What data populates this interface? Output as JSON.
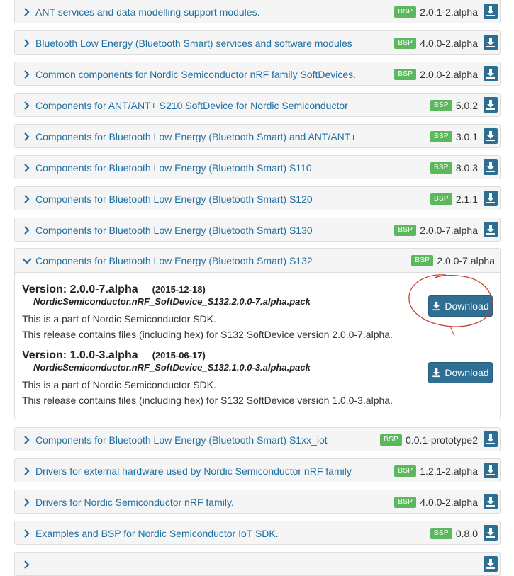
{
  "badge": "BSP",
  "packs_before": [
    {
      "title": "ANT services and data modelling support modules.",
      "version": "2.0.1-2.alpha"
    },
    {
      "title": "Bluetooth Low Energy (Bluetooth Smart) services and software modules",
      "version": "4.0.0-2.alpha"
    },
    {
      "title": "Common components for Nordic Semiconductor nRF family SoftDevices.",
      "version": "2.0.0-2.alpha"
    },
    {
      "title": "Components for ANT/ANT+ S210 SoftDevice for Nordic Semiconductor",
      "version": "5.0.2"
    },
    {
      "title": "Components for Bluetooth Low Energy (Bluetooth Smart) and ANT/ANT+",
      "version": "3.0.1"
    },
    {
      "title": "Components for Bluetooth Low Energy (Bluetooth Smart) S110",
      "version": "8.0.3"
    },
    {
      "title": "Components for Bluetooth Low Energy (Bluetooth Smart) S120",
      "version": "2.1.1"
    },
    {
      "title": "Components for Bluetooth Low Energy (Bluetooth Smart) S130",
      "version": "2.0.0-7.alpha"
    }
  ],
  "expanded": {
    "title": "Components for Bluetooth Low Energy (Bluetooth Smart) S132",
    "version": "2.0.0-7.alpha",
    "releases": [
      {
        "version_label": "Version: 2.0.0-7.alpha",
        "date": "(2015-12-18)",
        "pack": "NordicSemiconductor.nRF_SoftDevice_S132.2.0.0-7.alpha.pack",
        "desc1": "This is a part of Nordic Semiconductor SDK.",
        "desc2": "This release contains files (including hex) for S132 SoftDevice version 2.0.0-7.alpha.",
        "button": "Download"
      },
      {
        "version_label": "Version: 1.0.0-3.alpha",
        "date": "(2015-06-17)",
        "pack": "NordicSemiconductor.nRF_SoftDevice_S132.1.0.0-3.alpha.pack",
        "desc1": "This is a part of Nordic Semiconductor SDK.",
        "desc2": "This release contains files (including hex) for S132 SoftDevice version 1.0.0-3.alpha.",
        "button": "Download"
      }
    ]
  },
  "packs_after": [
    {
      "title": "Components for Bluetooth Low Energy (Bluetooth Smart) S1xx_iot",
      "version": "0.0.1-prototype2"
    },
    {
      "title": "Drivers for external hardware used by Nordic Semiconductor nRF family",
      "version": "1.2.1-2.alpha"
    },
    {
      "title": "Drivers for Nordic Semiconductor nRF family.",
      "version": "4.0.0-2.alpha"
    },
    {
      "title": "Examples and BSP for Nordic Semiconductor IoT SDK.",
      "version": "0.8.0"
    },
    {
      "title": "",
      "version": ""
    }
  ],
  "colors": {
    "link": "#1f6fa1",
    "badge": "#5cb85c",
    "download": "#2e6f93",
    "annotation": "#c0392b"
  }
}
